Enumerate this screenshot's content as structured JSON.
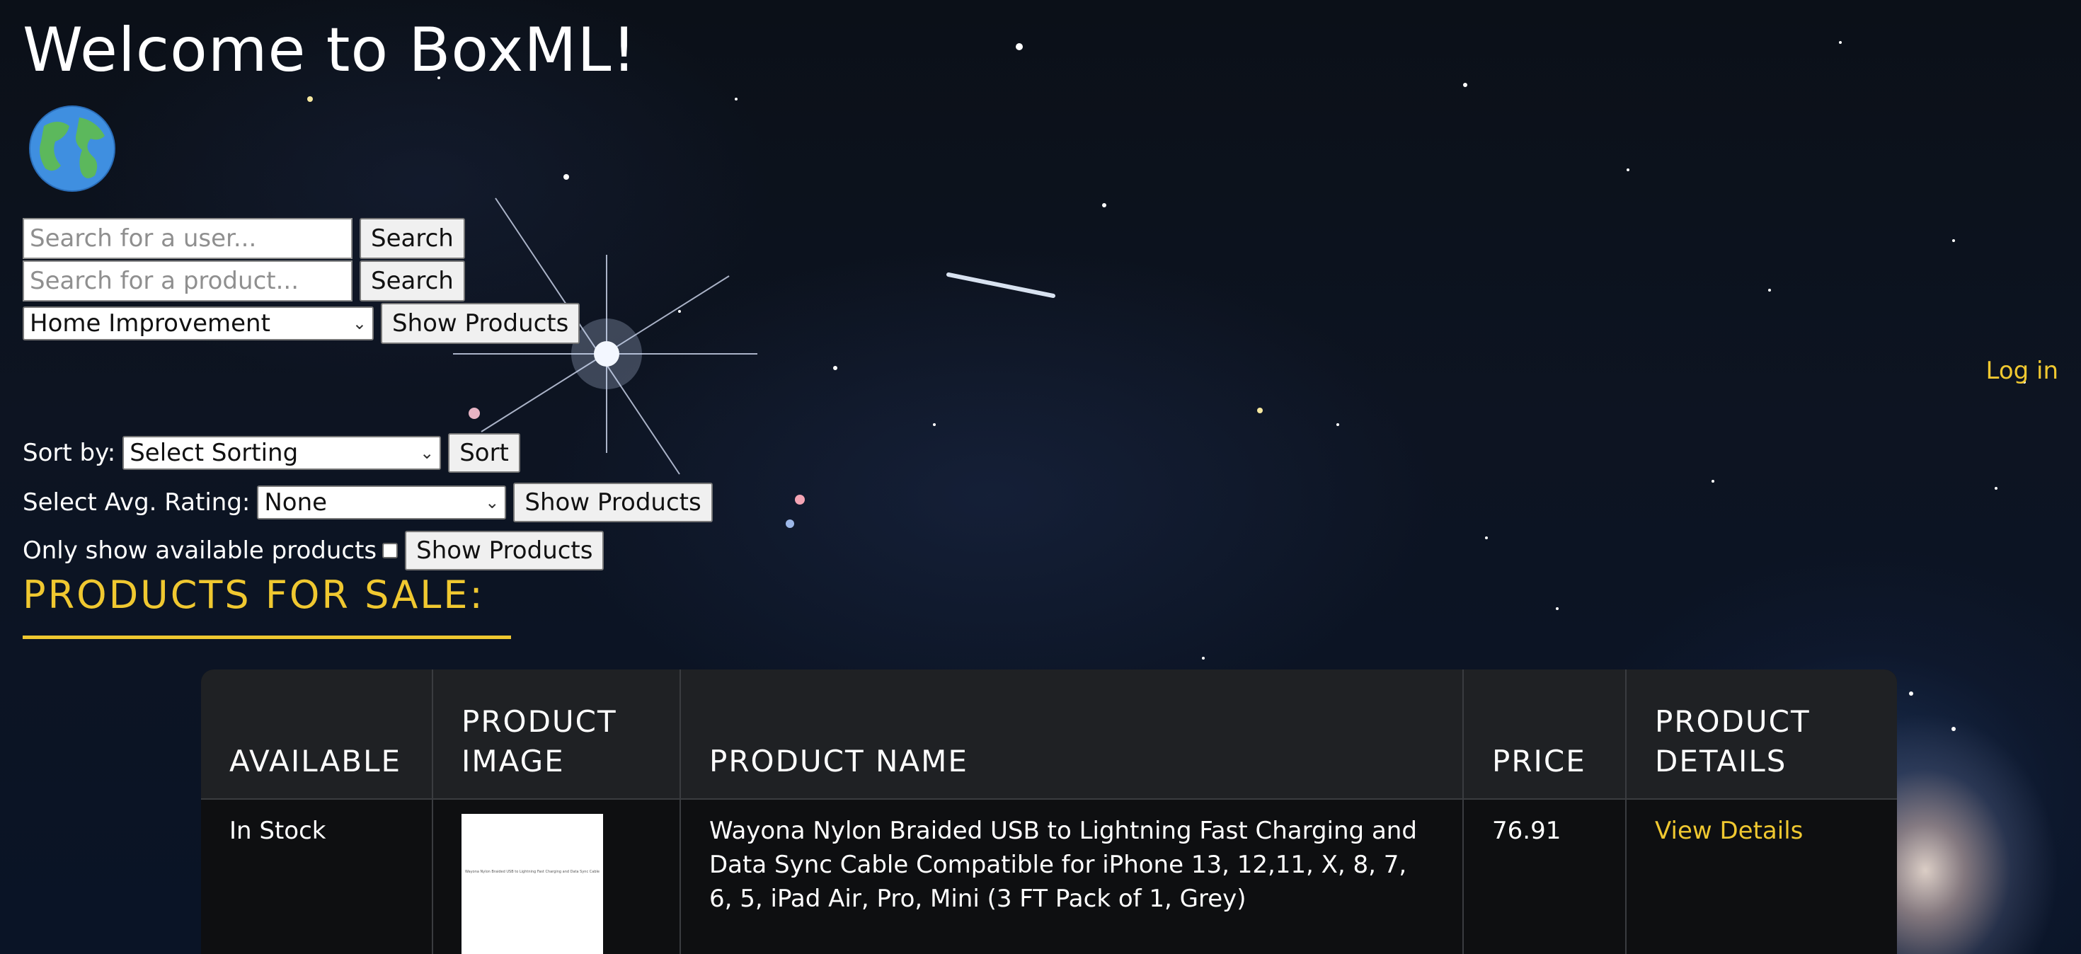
{
  "header": {
    "title": "Welcome to BoxML!"
  },
  "icons": {
    "globe": "globe-icon",
    "dropdown": "chevron-down-icon"
  },
  "search": {
    "user_placeholder": "Search for a user...",
    "product_placeholder": "Search for a product...",
    "button_label": "Search"
  },
  "category": {
    "selected": "Home Improvement",
    "button_label": "Show Products"
  },
  "nav": {
    "login_label": "Log in"
  },
  "sort": {
    "label": "Sort by:",
    "selected": "Select Sorting",
    "button_label": "Sort"
  },
  "rating": {
    "label": "Select Avg. Rating:",
    "selected": "None",
    "button_label": "Show Products"
  },
  "availability": {
    "label": "Only show available products",
    "checked": false,
    "button_label": "Show Products"
  },
  "products": {
    "section_title": "PRODUCTS FOR SALE:",
    "columns": [
      "AVAILABLE",
      "PRODUCT IMAGE",
      "PRODUCT NAME",
      "PRICE",
      "PRODUCT DETAILS"
    ],
    "rows": [
      {
        "available": "In Stock",
        "image_text": "Wayona Nylon Braided USB to Lightning Fast Charging and Data Sync Cable",
        "name": "Wayona Nylon Braided USB to Lightning Fast Charging and Data Sync Cable Compatible for iPhone 13, 12,11, X, 8, 7, 6, 5, iPad Air, Pro, Mini (3 FT Pack of 1, Grey)",
        "price": "76.91",
        "details_label": "View Details"
      }
    ]
  },
  "colors": {
    "accent": "#f0c830",
    "table_header_bg": "#1f2124",
    "table_body_bg": "#0e0f11"
  }
}
